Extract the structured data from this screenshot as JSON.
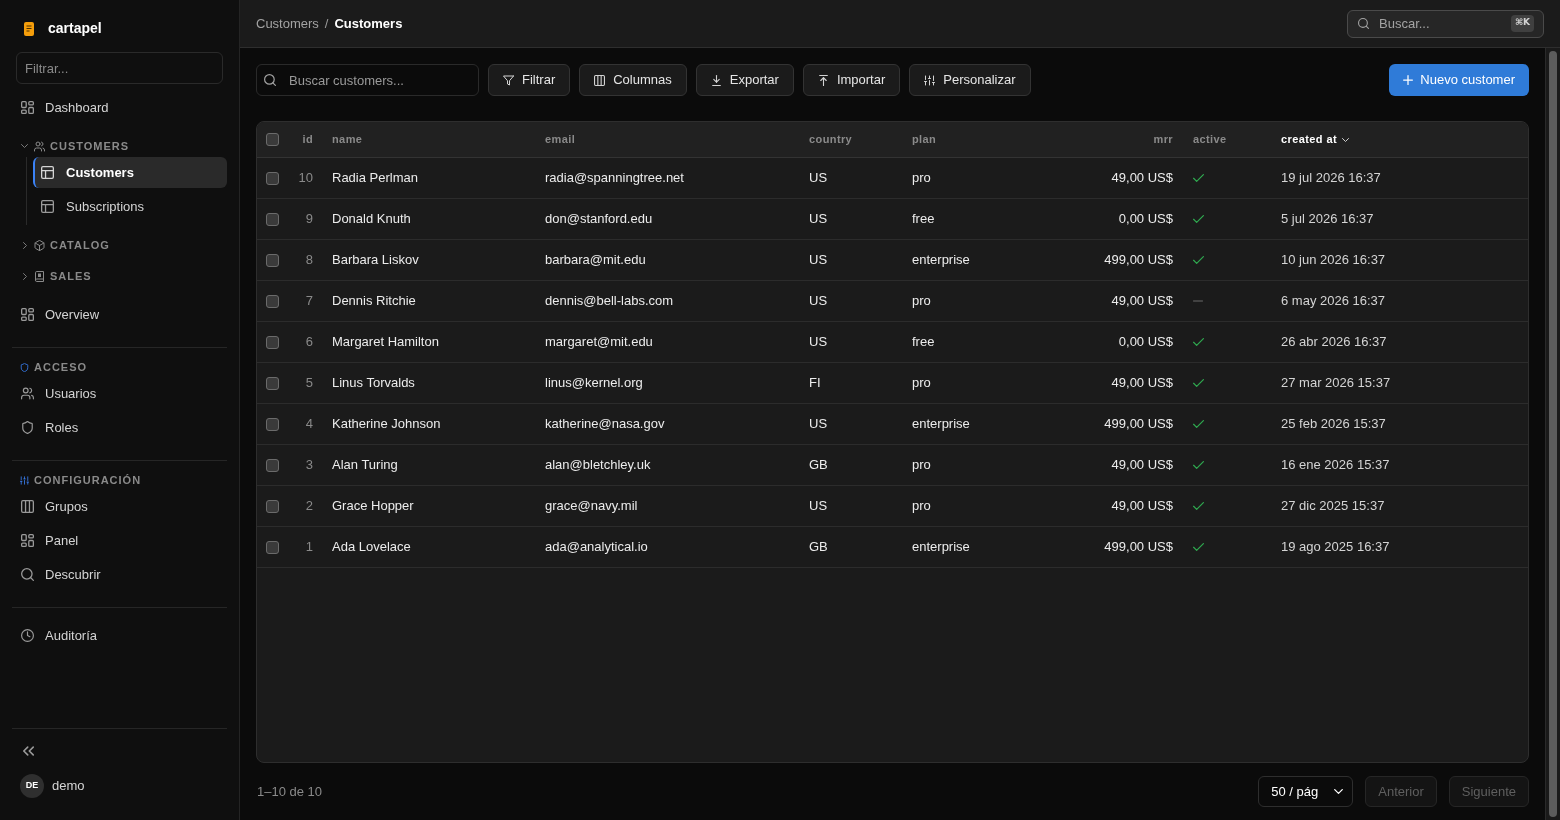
{
  "sidebar": {
    "brand": "cartapel",
    "filter": {
      "placeholder": "Filtrar..."
    },
    "nav": [
      {
        "kind": "link",
        "label": "Dashboard",
        "selected": false
      },
      {
        "kind": "group",
        "label": "CUSTOMERS",
        "expanded": true,
        "children": [
          {
            "label": "Customers",
            "selected": true
          },
          {
            "label": "Subscriptions",
            "selected": false
          }
        ]
      },
      {
        "kind": "group",
        "label": "CATALOG",
        "expanded": false
      },
      {
        "kind": "group",
        "label": "SALES",
        "expanded": false
      },
      {
        "kind": "link",
        "label": "Overview",
        "selected": false
      },
      {
        "kind": "section",
        "label": "ACCESO",
        "items": [
          {
            "label": "Usuarios",
            "selected": false
          },
          {
            "label": "Roles",
            "selected": false
          }
        ]
      },
      {
        "kind": "section",
        "label": "CONFIGURACIÓN",
        "items": [
          {
            "label": "Grupos",
            "selected": false
          },
          {
            "label": "Panel",
            "selected": false
          },
          {
            "label": "Descubrir",
            "selected": false
          }
        ]
      },
      {
        "kind": "section",
        "items": [
          {
            "label": "Auditoría",
            "selected": false
          }
        ]
      }
    ],
    "user": {
      "initials": "DE",
      "name": "demo"
    }
  },
  "header": {
    "breadcrumb": [
      "Customers",
      "Customers"
    ],
    "separator": "/",
    "search": {
      "placeholder": "Buscar...",
      "shortcut": "⌘K"
    }
  },
  "toolbar": {
    "search": {
      "placeholder": "Buscar customers..."
    },
    "buttons": [
      "Filtrar",
      "Columnas",
      "Exportar",
      "Importar",
      "Personalizar"
    ],
    "primary": "Nuevo customer"
  },
  "table": {
    "select_all": {
      "checked": false
    },
    "columns": [
      {
        "label": "id",
        "sorted": false
      },
      {
        "label": "name",
        "sorted": false
      },
      {
        "label": "email",
        "sorted": false
      },
      {
        "label": "country",
        "sorted": false
      },
      {
        "label": "plan",
        "sorted": false
      },
      {
        "label": "mrr",
        "sorted": false
      },
      {
        "label": "active",
        "sorted": false
      },
      {
        "label": "created at",
        "sorted": true
      }
    ],
    "rows": [
      {
        "selected": false,
        "id": "10",
        "name": "Radia Perlman",
        "email": "radia@spanningtree.net",
        "country": "US",
        "plan": "pro",
        "mrr": "49,00 US$",
        "active": true,
        "created_at": "19 jul 2026 16:37"
      },
      {
        "selected": false,
        "id": "9",
        "name": "Donald Knuth",
        "email": "don@stanford.edu",
        "country": "US",
        "plan": "free",
        "mrr": "0,00 US$",
        "active": true,
        "created_at": "5 jul 2026 16:37"
      },
      {
        "selected": false,
        "id": "8",
        "name": "Barbara Liskov",
        "email": "barbara@mit.edu",
        "country": "US",
        "plan": "enterprise",
        "mrr": "499,00 US$",
        "active": true,
        "created_at": "10 jun 2026 16:37"
      },
      {
        "selected": false,
        "id": "7",
        "name": "Dennis Ritchie",
        "email": "dennis@bell-labs.com",
        "country": "US",
        "plan": "pro",
        "mrr": "49,00 US$",
        "active": false,
        "created_at": "6 may 2026 16:37"
      },
      {
        "selected": false,
        "id": "6",
        "name": "Margaret Hamilton",
        "email": "margaret@mit.edu",
        "country": "US",
        "plan": "free",
        "mrr": "0,00 US$",
        "active": true,
        "created_at": "26 abr 2026 16:37"
      },
      {
        "selected": false,
        "id": "5",
        "name": "Linus Torvalds",
        "email": "linus@kernel.org",
        "country": "FI",
        "plan": "pro",
        "mrr": "49,00 US$",
        "active": true,
        "created_at": "27 mar 2026 15:37"
      },
      {
        "selected": false,
        "id": "4",
        "name": "Katherine Johnson",
        "email": "katherine@nasa.gov",
        "country": "US",
        "plan": "enterprise",
        "mrr": "499,00 US$",
        "active": true,
        "created_at": "25 feb 2026 15:37"
      },
      {
        "selected": false,
        "id": "3",
        "name": "Alan Turing",
        "email": "alan@bletchley.uk",
        "country": "GB",
        "plan": "pro",
        "mrr": "49,00 US$",
        "active": true,
        "created_at": "16 ene 2026 15:37"
      },
      {
        "selected": false,
        "id": "2",
        "name": "Grace Hopper",
        "email": "grace@navy.mil",
        "country": "US",
        "plan": "pro",
        "mrr": "49,00 US$",
        "active": true,
        "created_at": "27 dic 2025 15:37"
      },
      {
        "selected": false,
        "id": "1",
        "name": "Ada Lovelace",
        "email": "ada@analytical.io",
        "country": "GB",
        "plan": "enterprise",
        "mrr": "499,00 US$",
        "active": true,
        "created_at": "19 ago 2025 16:37"
      }
    ]
  },
  "pagination": {
    "summary": "1–10 de 10",
    "page_size": "50 / pág",
    "previous": {
      "label": "Anterior",
      "disabled": true
    },
    "next": {
      "label": "Siguiente",
      "disabled": true
    }
  }
}
